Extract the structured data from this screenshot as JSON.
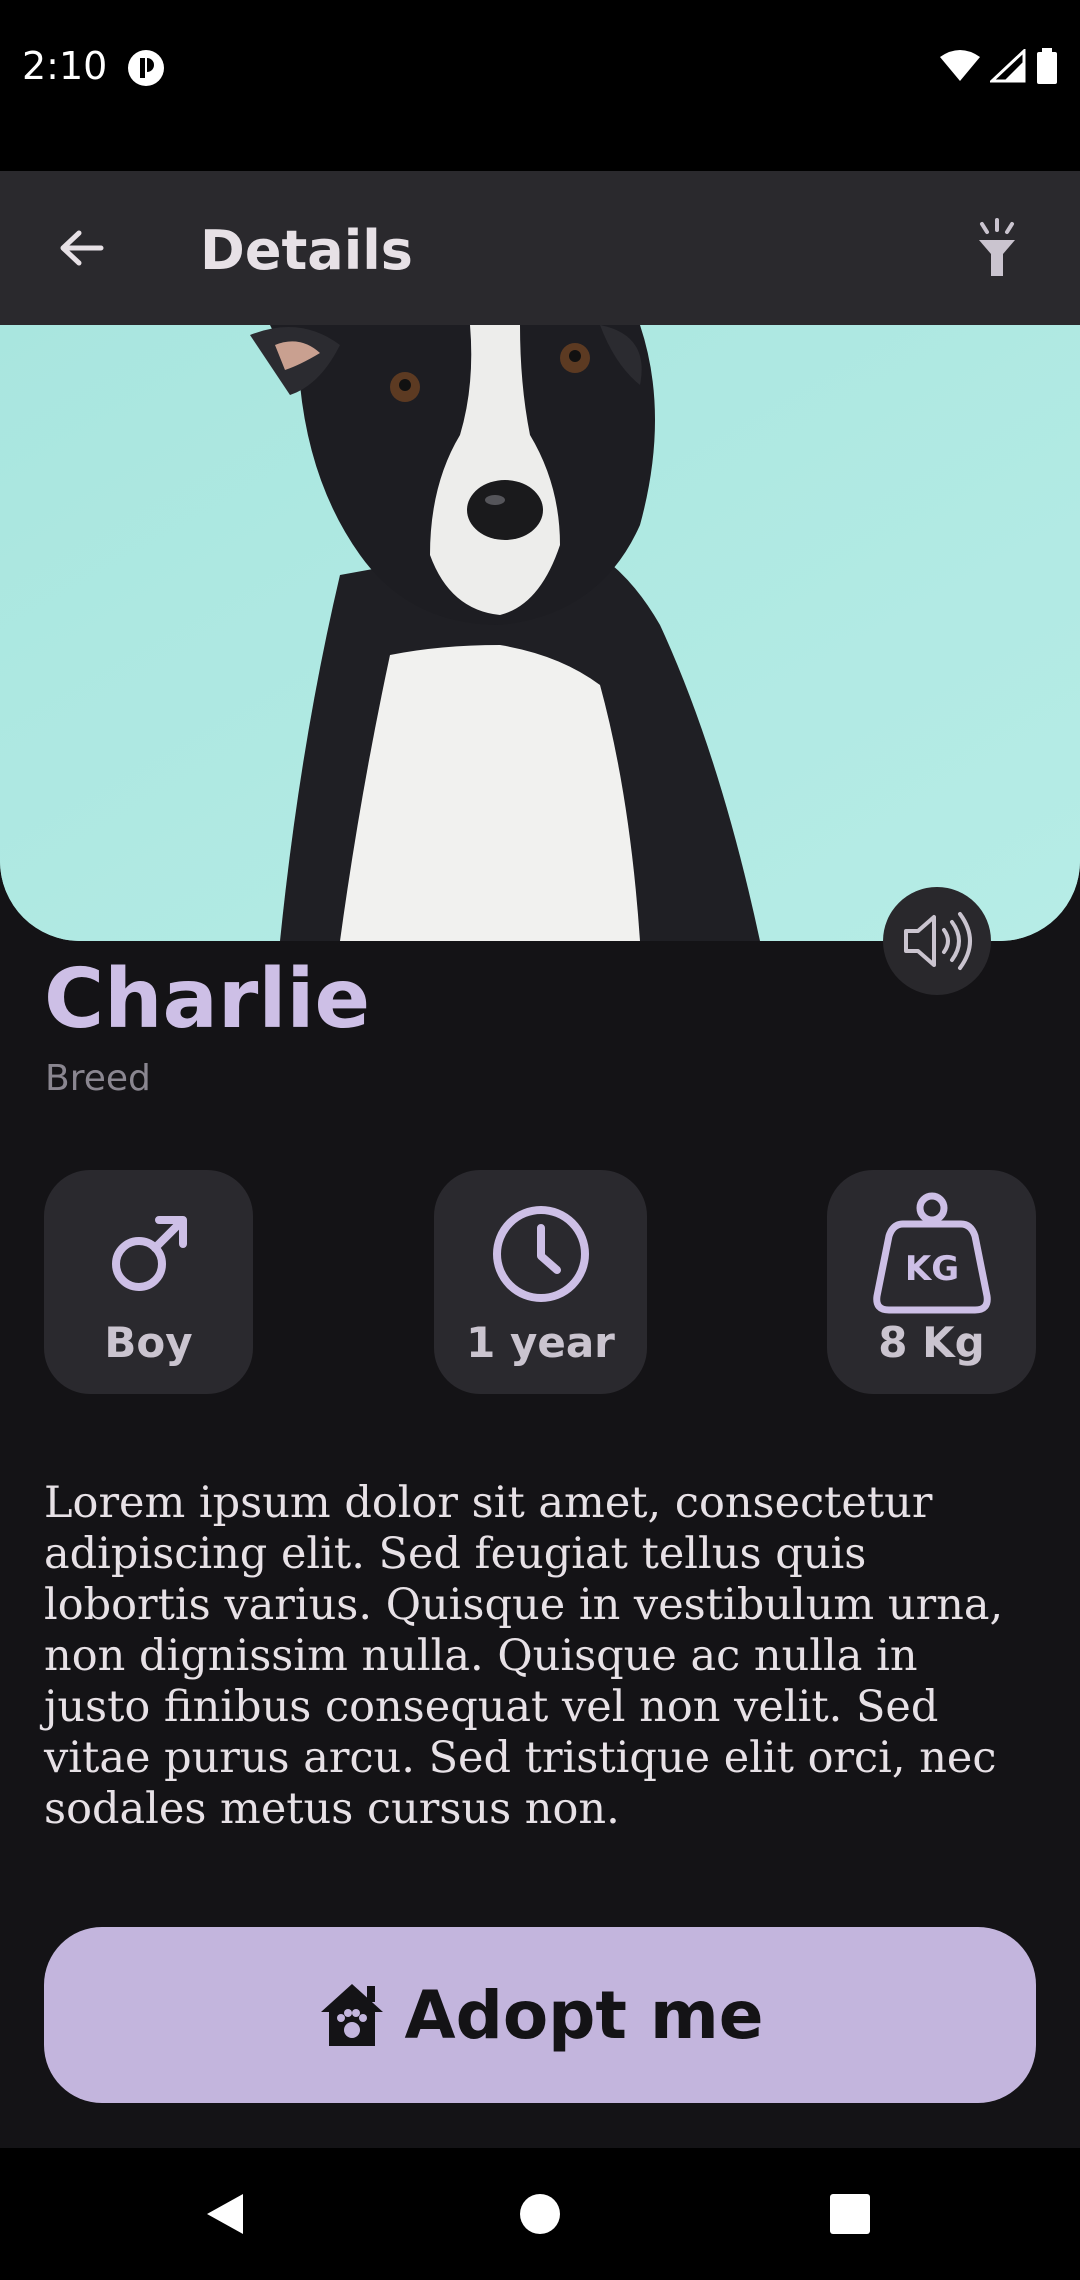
{
  "status_bar": {
    "time": "2:10"
  },
  "app_bar": {
    "title": "Details"
  },
  "pet": {
    "name": "Charlie",
    "breed": "Breed",
    "gender": "Boy",
    "age": "1 year",
    "weight": "8 Kg",
    "weight_icon_text": "KG"
  },
  "description": "Lorem ipsum dolor sit amet, consectetur adipiscing elit. Sed feugiat tellus quis lobortis varius. Quisque in vestibulum urna, non dignissim nulla. Quisque ac nulla in justo finibus consequat vel non velit. Sed vitae purus arcu. Sed tristique elit orci, nec sodales metus cursus non.",
  "actions": {
    "adopt_label": "Adopt me"
  },
  "colors": {
    "accent": "#cdbfe6",
    "button": "#c3b5dd",
    "background": "#141316",
    "app_bar": "#2a292d",
    "card": "#2a292e"
  },
  "icons": [
    "back-arrow-icon",
    "flashlight-icon",
    "volume-icon",
    "male-icon",
    "clock-icon",
    "weight-icon",
    "pet-house-icon"
  ]
}
